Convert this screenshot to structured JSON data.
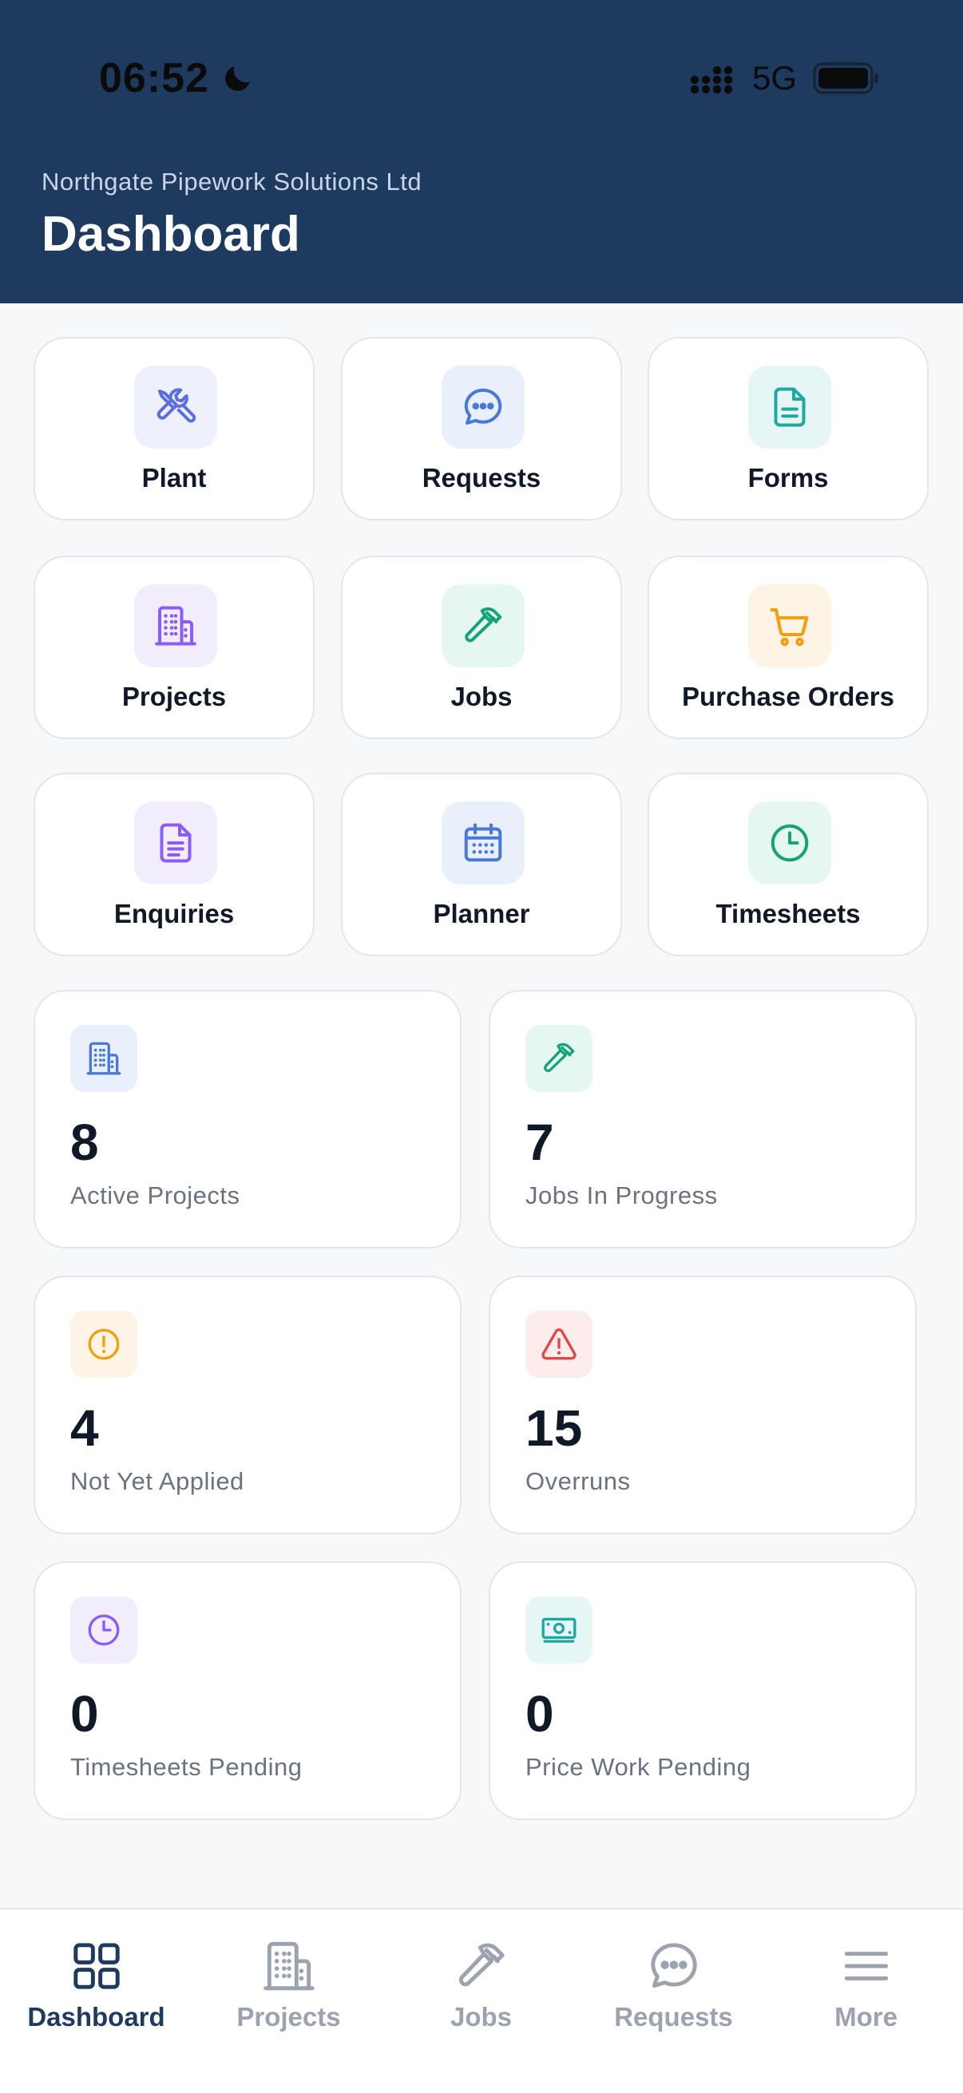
{
  "status": {
    "time": "06:52",
    "network": "5G"
  },
  "header": {
    "company": "Northgate Pipework Solutions Ltd",
    "title": "Dashboard"
  },
  "tiles": [
    {
      "label": "Plant",
      "icon": "tools-icon",
      "color": "#5b6ee1",
      "bg": "#eef0fc"
    },
    {
      "label": "Requests",
      "icon": "chat-bubble-icon",
      "color": "#4a78d8",
      "bg": "#eaf0fb"
    },
    {
      "label": "Forms",
      "icon": "document-icon",
      "color": "#1ea9a0",
      "bg": "#e6f6f5"
    },
    {
      "label": "Projects",
      "icon": "building-icon",
      "color": "#8b5cf6",
      "bg": "#f2edfd"
    },
    {
      "label": "Jobs",
      "icon": "hammer-icon",
      "color": "#16a37a",
      "bg": "#e6f6f0"
    },
    {
      "label": "Purchase Orders",
      "icon": "cart-icon",
      "color": "#f59e0b",
      "bg": "#fdf4e6"
    },
    {
      "label": "Enquiries",
      "icon": "document-lines-icon",
      "color": "#8b5cf6",
      "bg": "#f2edfd"
    },
    {
      "label": "Planner",
      "icon": "calendar-icon",
      "color": "#4a78d8",
      "bg": "#eaf0fb"
    },
    {
      "label": "Timesheets",
      "icon": "clock-icon",
      "color": "#16a37a",
      "bg": "#e6f6f0"
    }
  ],
  "stats": [
    {
      "value": "8",
      "caption": "Active Projects",
      "icon": "building-icon",
      "color": "#4a78d8",
      "bg": "#eaf0fb"
    },
    {
      "value": "7",
      "caption": "Jobs In Progress",
      "icon": "hammer-icon",
      "color": "#16a37a",
      "bg": "#e6f6f0"
    },
    {
      "value": "4",
      "caption": "Not Yet Applied",
      "icon": "alert-circle-icon",
      "color": "#f59e0b",
      "bg": "#fdf4e6"
    },
    {
      "value": "15",
      "caption": "Overruns",
      "icon": "warning-triangle-icon",
      "color": "#e04848",
      "bg": "#fdecec"
    },
    {
      "value": "0",
      "caption": "Timesheets Pending",
      "icon": "clock-icon",
      "color": "#8b5cf6",
      "bg": "#f2edfd"
    },
    {
      "value": "0",
      "caption": "Price Work Pending",
      "icon": "banknote-icon",
      "color": "#1ea9a0",
      "bg": "#e6f6f5"
    }
  ],
  "tabbar": {
    "active_color": "#1f3a5f",
    "inactive_color": "#9ca3af",
    "items": [
      {
        "label": "Dashboard",
        "icon": "grid-icon",
        "active": true
      },
      {
        "label": "Projects",
        "icon": "building-icon",
        "active": false
      },
      {
        "label": "Jobs",
        "icon": "hammer-icon",
        "active": false
      },
      {
        "label": "Requests",
        "icon": "chat-bubble-icon",
        "active": false
      },
      {
        "label": "More",
        "icon": "menu-icon",
        "active": false
      }
    ]
  }
}
